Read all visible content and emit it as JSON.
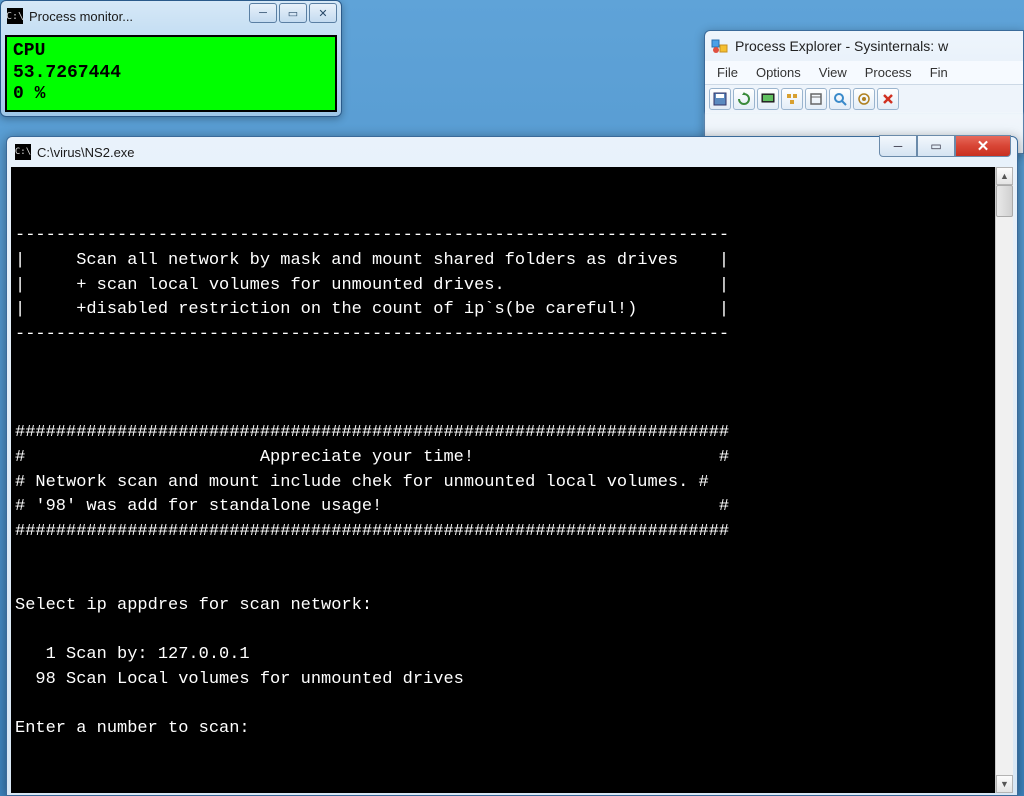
{
  "procmon": {
    "title": "Process monitor...",
    "icon_glyph": "C:\\",
    "body_line1": "CPU",
    "body_line2": "53.7267444",
    "body_line3": "0 %"
  },
  "pexp": {
    "title": "Process Explorer - Sysinternals: w",
    "menu": {
      "file": "File",
      "options": "Options",
      "view": "View",
      "process": "Process",
      "find": "Fin"
    }
  },
  "console": {
    "title": "C:\\virus\\NS2.exe",
    "icon_glyph": "C:\\",
    "lines": [
      "",
      "",
      "----------------------------------------------------------------------",
      "|     Scan all network by mask and mount shared folders as drives    |",
      "|     + scan local volumes for unmounted drives.                     |",
      "|     +disabled restriction on the count of ip`s(be careful!)        |",
      "----------------------------------------------------------------------",
      "",
      "",
      "",
      "######################################################################",
      "#                       Appreciate your time!                        #",
      "# Network scan and mount include chek for unmounted local volumes. #",
      "# '98' was add for standalone usage!                                 #",
      "######################################################################",
      "",
      "",
      "Select ip appdres for scan network:",
      "",
      "   1 Scan by: 127.0.0.1",
      "  98 Scan Local volumes for unmounted drives",
      "",
      "Enter a number to scan:"
    ]
  }
}
